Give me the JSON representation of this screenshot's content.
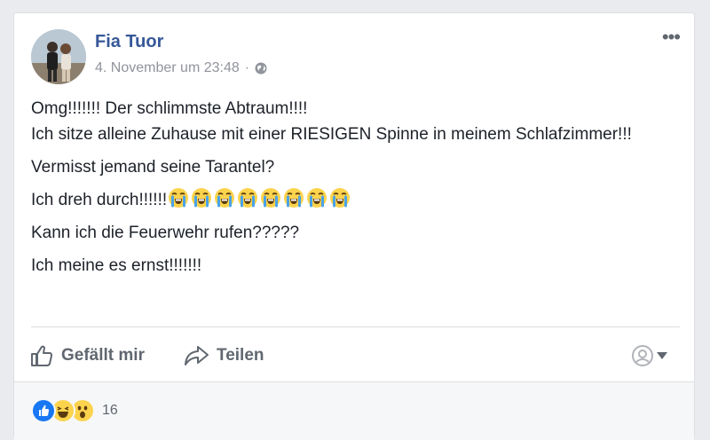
{
  "post": {
    "author": "Fia Tuor",
    "timestamp": "4. November um 23:48",
    "separator": "·",
    "privacy_icon": "globe-icon",
    "lines": [
      "Omg!!!!!!! Der schlimmste Abtraum!!!!",
      "Ich sitze alleine Zuhause mit einer RIESIGEN Spinne in meinem Schlafzimmer!!!",
      "Vermisst jemand seine Tarantel?",
      "Ich dreh durch!!!!!!",
      "Kann ich die Feuerwehr rufen?????",
      "Ich meine es ernst!!!!!!!"
    ],
    "crying_emoji_count": 8
  },
  "actions": {
    "like_label": "Gefällt mir",
    "share_label": "Teilen"
  },
  "reactions": {
    "icons": [
      "like-icon",
      "haha-icon",
      "wow-icon"
    ],
    "count": "16"
  },
  "colors": {
    "author": "#365899",
    "meta": "#90949c",
    "action": "#606770",
    "like_blue": "#1877f2",
    "emoji_yellow": "#fcd34d"
  }
}
